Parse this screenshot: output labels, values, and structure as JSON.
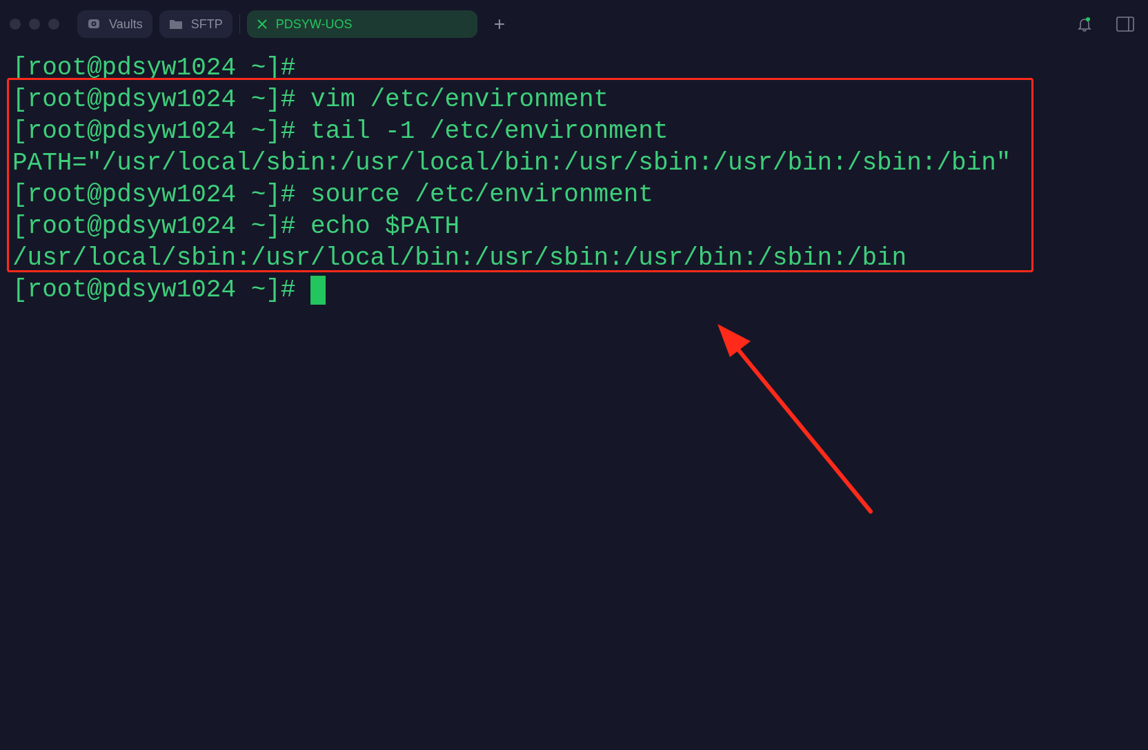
{
  "tabs": [
    {
      "kind": "vaults",
      "label": "Vaults",
      "selected": false
    },
    {
      "kind": "sftp",
      "label": "SFTP",
      "selected": false
    },
    {
      "kind": "session",
      "label": "PDSYW-UOS",
      "selected": true
    }
  ],
  "new_tab": "+",
  "notifications": {
    "unread": true
  },
  "terminal": {
    "lines": [
      "[root@pdsyw1024 ~]#",
      "[root@pdsyw1024 ~]# vim /etc/environment",
      "[root@pdsyw1024 ~]# tail -1 /etc/environment",
      "PATH=\"/usr/local/sbin:/usr/local/bin:/usr/sbin:/usr/bin:/sbin:/bin\"",
      "[root@pdsyw1024 ~]# source /etc/environment",
      "[root@pdsyw1024 ~]# echo $PATH",
      "/usr/local/sbin:/usr/local/bin:/usr/sbin:/usr/bin:/sbin:/bin",
      "[root@pdsyw1024 ~]# "
    ],
    "cursor": true
  },
  "annotations": {
    "highlight_box": true,
    "arrow": true
  }
}
